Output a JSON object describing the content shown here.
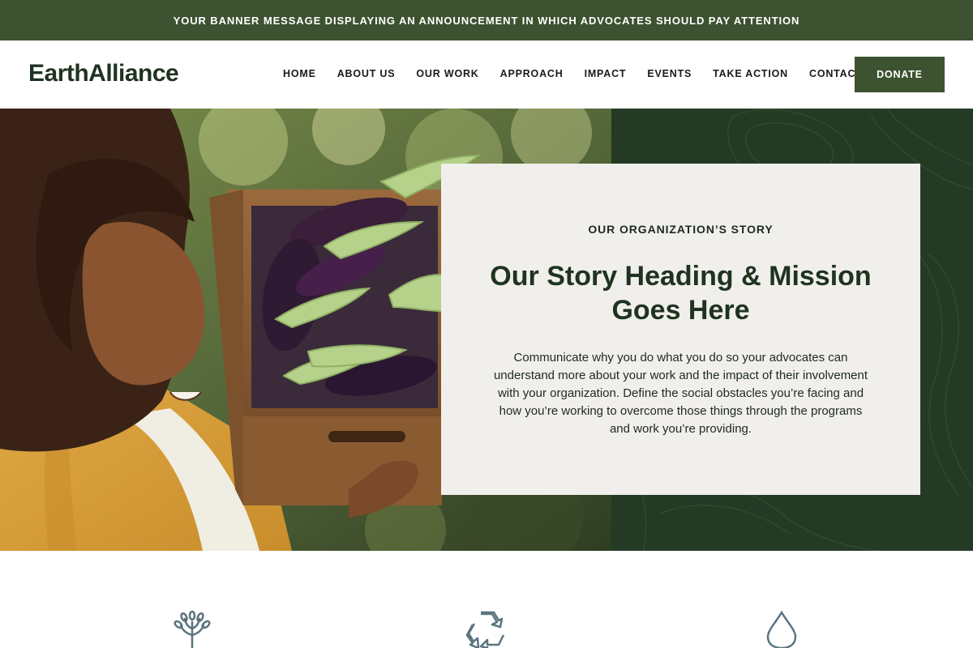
{
  "banner": {
    "message": "YOUR BANNER MESSAGE DISPLAYING AN ANNOUNCEMENT IN WHICH ADVOCATES SHOULD PAY ATTENTION"
  },
  "header": {
    "logo": "EarthAlliance",
    "nav": [
      "HOME",
      "ABOUT US",
      "OUR WORK",
      "APPROACH",
      "IMPACT",
      "EVENTS",
      "TAKE ACTION",
      "CONTACT"
    ],
    "donate_label": "DONATE"
  },
  "story": {
    "eyebrow": "OUR ORGANIZATION’S STORY",
    "heading": "Our Story Heading & Mission Goes Here",
    "body": "Communicate why you do what you do so your advocates can understand more about your work and the impact of their involvement with your organization. Define the social obstacles you’re facing and how you’re working to overcome those things through the programs and work you’re providing."
  },
  "features": {
    "icons": [
      "tree-icon",
      "recycle-icon",
      "water-drop-icon"
    ]
  },
  "colors": {
    "brand_green": "#3d5230",
    "dark_green": "#243a25",
    "card_bg": "#f1efeb",
    "icon_slate": "#5b7480"
  }
}
